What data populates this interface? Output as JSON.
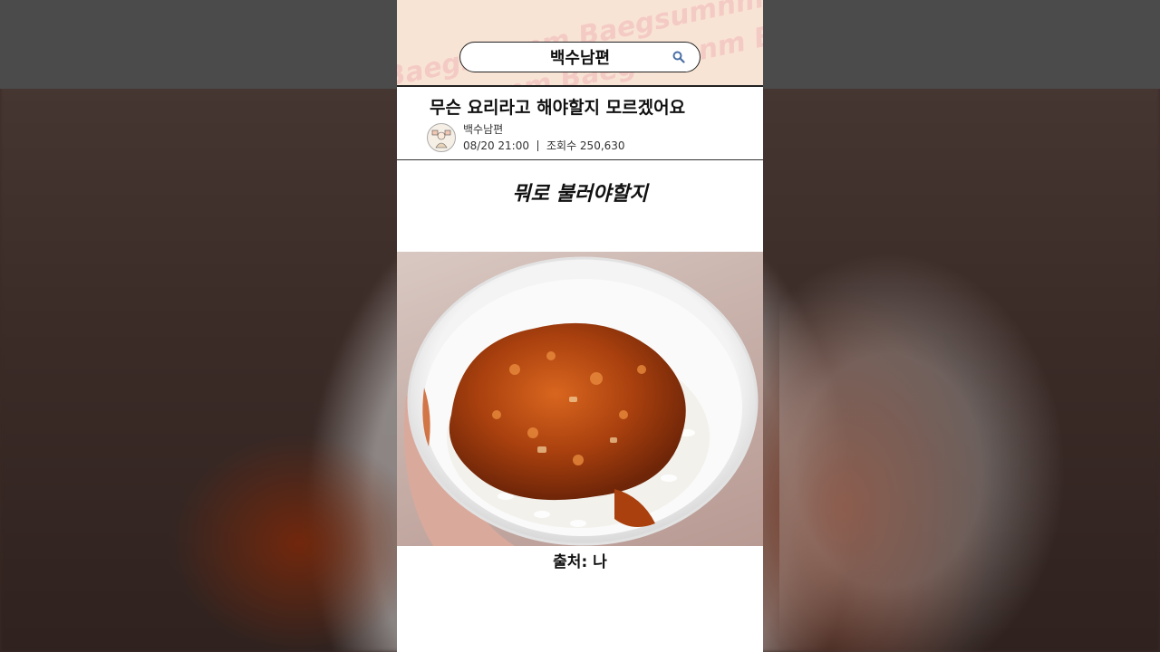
{
  "header": {
    "search_text": "백수남편",
    "watermark_text": "Baegsumnm Baegsumnm Baegsumnm"
  },
  "post": {
    "title": "무슨 요리라고 해야할지 모르겠어요",
    "author": "백수남편",
    "datetime": "08/20 21:00",
    "views_label": "조회수 250,630",
    "caption": "뭐로 불러야할지",
    "source": "출처: 나"
  },
  "colors": {
    "header_bg": "#f8e4d4",
    "sauce": "#b5450f"
  },
  "icons": {
    "search": "search-icon",
    "avatar": "avatar-illustration"
  }
}
